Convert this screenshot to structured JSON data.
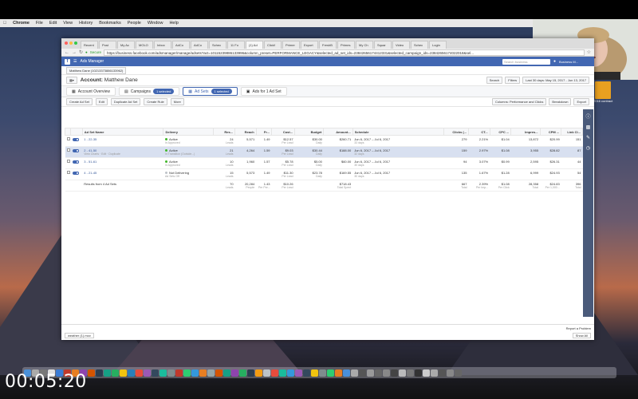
{
  "mac_menu": {
    "app": "Chrome",
    "items": [
      "File",
      "Edit",
      "View",
      "History",
      "Bookmarks",
      "People",
      "Window",
      "Help"
    ]
  },
  "browser_tabs": [
    "Recent",
    "Post",
    "My Ac",
    "MOLO",
    "Inbox",
    "AdCo",
    "AdCo",
    "Schec",
    "11 Fo",
    "(1) Ad",
    "Clickf",
    "Primer",
    "Export",
    "FreshB",
    "Primes",
    "My Ch",
    "Squar",
    "Video",
    "Schec",
    "Login"
  ],
  "url": {
    "secure": "Secure",
    "text": "https://business.facebook.com/adsmanager/manage/adsets?act=10115239886133996&column_preset=PERFORMANCE_LEGACY&selected_ad_set_ids=23842656174412331&selected_campaign_ids=23842656174022018&sel..."
  },
  "fb": {
    "title": "Ads Manager",
    "search_placeholder": "Search business",
    "user": "Business M..."
  },
  "account": {
    "selector": "Matthew Dane (10213373886133962)",
    "label": "Account:",
    "name": "Matthew Dane"
  },
  "top_buttons": {
    "search": "Search",
    "filters": "Filters",
    "date_range": "Last 30 days: May 15, 2017 - Jun 13, 2017"
  },
  "level_tabs": {
    "overview": "Account Overview",
    "campaigns": "Campaigns",
    "campaigns_selected": "1 selected",
    "adsets": "Ad Sets",
    "adsets_selected": "1 selected",
    "ads": "Ads for 1 Ad Set"
  },
  "toolbar": {
    "create": "Create Ad Set",
    "edit": "Edit",
    "duplicate": "Duplicate Ad Set",
    "create_rule": "Create Rule",
    "more": "More",
    "columns": "Columns: Performance and Clicks",
    "breakdown": "Breakdown",
    "export": "Export"
  },
  "columns": [
    "Ad Set Name",
    "Delivery",
    "Res...",
    "Reach",
    "Fr...",
    "Cost...",
    "Budget",
    "Amount...",
    "Schedule",
    "Clicks (...",
    "CT...",
    "CPC ...",
    "Impres...",
    "CPM ...",
    "Link Cl..."
  ],
  "rows": [
    {
      "name": "1 - 22-35",
      "sub": "",
      "status": "Active",
      "status_sub": "In Approved",
      "dot": "#42b72a",
      "results": "24",
      "results_sub": "Leads",
      "reach": "5,571",
      "freq": "1.49",
      "cost": "$12.57",
      "cost_sub": "Per Lead",
      "budget": "$30.00",
      "budget_sub": "Daily",
      "spent": "$260.71",
      "schedule": "Jun 6, 2017 – Jul 6, 2017",
      "schedule_sub": "33 days",
      "clicks": "279",
      "ctr": "2.21%",
      "cpc": "$1.04",
      "impr": "13,872",
      "cpm": "$20.99",
      "link": "151",
      "selected": false
    },
    {
      "name": "2 - 41-50",
      "sub": "View Charts · Edit · Duplicate",
      "status": "Active",
      "status_sub": "In Transition (Outside...)",
      "dot": "#42b72a",
      "results": "21",
      "results_sub": "Leads",
      "reach": "4,264",
      "freq": "1.59",
      "cost": "$9.03",
      "cost_sub": "Per Lead",
      "budget": "$30.44",
      "budget_sub": "Daily",
      "spent": "$188.00",
      "schedule": "Jun 6, 2017 – Jul 6, 2017",
      "schedule_sub": "32 days",
      "clicks": "159",
      "ctr": "2.97%",
      "cpc": "$1.08",
      "impr": "3,955",
      "cpm": "$28.82",
      "link": "87",
      "selected": true
    },
    {
      "name": "3 - 51-61",
      "sub": "",
      "status": "Active",
      "status_sub": "In Approved",
      "dot": "#42b72a",
      "results": "10",
      "results_sub": "Leads",
      "reach": "1,960",
      "freq": "1.57",
      "cost": "$5.78",
      "cost_sub": "Per Lead",
      "budget": "$5.00",
      "budget_sub": "Daily",
      "spent": "$60.00",
      "schedule": "Jun 6, 2017 – Jul 6, 2017",
      "schedule_sub": "30 days",
      "clicks": "94",
      "ctr": "3.07%",
      "cpc": "$0.99",
      "impr": "2,595",
      "cpm": "$26.31",
      "link": "44",
      "selected": false
    },
    {
      "name": "4 - 21-45",
      "sub": "",
      "status": "Not Delivering",
      "status_sub": "Ad Sets Off",
      "dot": "#bec3c9",
      "results": "15",
      "results_sub": "Leads",
      "reach": "5,573",
      "freq": "1.49",
      "cost": "$11.30",
      "cost_sub": "Per Lead",
      "budget": "$23.78",
      "budget_sub": "Daily",
      "spent": "$169.55",
      "schedule": "Jun 6, 2017 – Jul 6, 2017",
      "schedule_sub": "30 days",
      "clicks": "135",
      "ctr": "1.67%",
      "cpc": "$1.28",
      "impr": "6,999",
      "cpm": "$24.93",
      "link": "54",
      "selected": false
    }
  ],
  "totals": {
    "name": "Results from 4 Ad Sets",
    "results": "70",
    "results_sub": "Leads",
    "reach": "20,284",
    "reach_sub": "People",
    "freq": "1.43",
    "freq_sub": "Per Per...",
    "cost": "$10.26",
    "cost_sub": "Per Lead",
    "spent": "$718.43",
    "spent_sub": "Total Spent",
    "clicks": "667",
    "clicks_sub": "Total",
    "ctr": "2.39%",
    "ctr_sub": "Per Imp...",
    "cpc": "$1.08",
    "cpc_sub": "Per Click",
    "impr": "28,358",
    "impr_sub": "Total",
    "cpm": "$24.83",
    "cpm_sub": "Per 1,000...",
    "link": "396",
    "link_sub": "Total"
  },
  "footer": {
    "report": "Report a Problem",
    "download": "weather (1).mov",
    "show_all": "Show All"
  },
  "desktop_icon": "2016 contract",
  "timestamp": "00:05:20"
}
